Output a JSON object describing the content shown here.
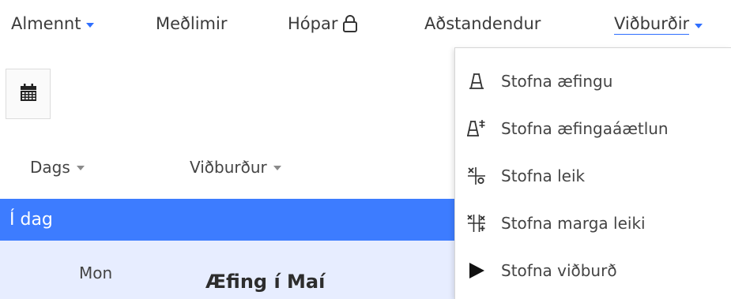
{
  "nav": {
    "items": [
      {
        "label": "Almennt",
        "has_caret": true
      },
      {
        "label": "Meðlimir"
      },
      {
        "label": "Hópar",
        "icon": "lock-icon"
      },
      {
        "label": "Aðstandendur"
      },
      {
        "label": "Viðburðir",
        "has_caret": true,
        "active": true
      }
    ]
  },
  "toolbar": {
    "calendar_icon": "calendar-icon"
  },
  "table": {
    "columns": [
      {
        "label": "Dags"
      },
      {
        "label": "Viðburður"
      }
    ]
  },
  "today": {
    "label": "Í dag"
  },
  "event": {
    "day": "Mon",
    "title": "Æfing í Maí"
  },
  "dropdown": {
    "items": [
      {
        "label": "Stofna æfingu",
        "icon": "training-icon"
      },
      {
        "label": "Stofna æfingaáætlun",
        "icon": "training-plan-icon"
      },
      {
        "label": "Stofna leik",
        "icon": "match-icon"
      },
      {
        "label": "Stofna marga leiki",
        "icon": "multiple-matches-icon"
      },
      {
        "label": "Stofna viðburð",
        "icon": "play-icon"
      }
    ]
  },
  "colors": {
    "accent": "#3d7cff",
    "row_highlight": "#e7edff",
    "caret": "#2f6fff"
  }
}
